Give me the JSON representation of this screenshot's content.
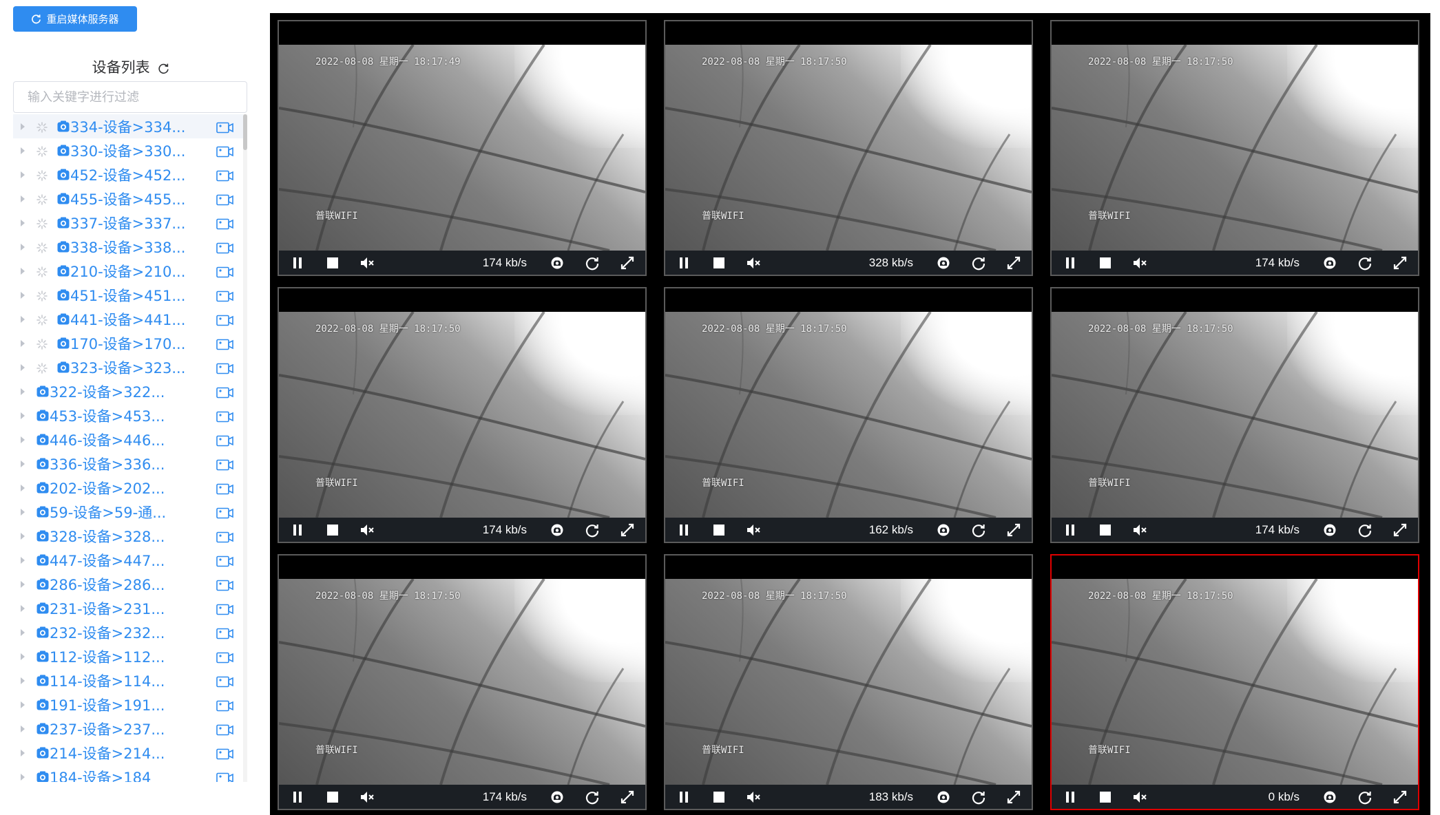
{
  "left_panel": {
    "restart_button_label": "重启媒体服务器",
    "device_list_title": "设备列表",
    "filter_placeholder": "输入关键字进行过滤",
    "accent_color": "#2f8cf0",
    "devices": [
      {
        "label": "334-设备>334...",
        "loading": true
      },
      {
        "label": "330-设备>330...",
        "loading": true
      },
      {
        "label": "452-设备>452...",
        "loading": true
      },
      {
        "label": "455-设备>455...",
        "loading": true
      },
      {
        "label": "337-设备>337...",
        "loading": true
      },
      {
        "label": "338-设备>338...",
        "loading": true
      },
      {
        "label": "210-设备>210...",
        "loading": true
      },
      {
        "label": "451-设备>451...",
        "loading": true
      },
      {
        "label": "441-设备>441...",
        "loading": true
      },
      {
        "label": "170-设备>170...",
        "loading": true
      },
      {
        "label": "323-设备>323...",
        "loading": true
      },
      {
        "label": "322-设备>322...",
        "loading": false
      },
      {
        "label": "453-设备>453...",
        "loading": false
      },
      {
        "label": "446-设备>446...",
        "loading": false
      },
      {
        "label": "336-设备>336...",
        "loading": false
      },
      {
        "label": "202-设备>202...",
        "loading": false
      },
      {
        "label": "59-设备>59-通...",
        "loading": false
      },
      {
        "label": "328-设备>328...",
        "loading": false
      },
      {
        "label": "447-设备>447...",
        "loading": false
      },
      {
        "label": "286-设备>286...",
        "loading": false
      },
      {
        "label": "231-设备>231...",
        "loading": false
      },
      {
        "label": "232-设备>232...",
        "loading": false
      },
      {
        "label": "112-设备>112...",
        "loading": false
      },
      {
        "label": "114-设备>114...",
        "loading": false
      },
      {
        "label": "191-设备>191...",
        "loading": false
      },
      {
        "label": "237-设备>237...",
        "loading": false
      },
      {
        "label": "214-设备>214...",
        "loading": false
      },
      {
        "label": "184-设备>184",
        "loading": false
      }
    ]
  },
  "players": [
    {
      "timestamp": "2022-08-08 星期一 18:17:49",
      "channel_name": "普联WIFI",
      "bitrate": "174 kb/s",
      "selected": false
    },
    {
      "timestamp": "2022-08-08 星期一 18:17:50",
      "channel_name": "普联WIFI",
      "bitrate": "328 kb/s",
      "selected": false
    },
    {
      "timestamp": "2022-08-08 星期一 18:17:50",
      "channel_name": "普联WIFI",
      "bitrate": "174 kb/s",
      "selected": false
    },
    {
      "timestamp": "2022-08-08 星期一 18:17:50",
      "channel_name": "普联WIFI",
      "bitrate": "174 kb/s",
      "selected": false
    },
    {
      "timestamp": "2022-08-08 星期一 18:17:50",
      "channel_name": "普联WIFI",
      "bitrate": "162 kb/s",
      "selected": false
    },
    {
      "timestamp": "2022-08-08 星期一 18:17:50",
      "channel_name": "普联WIFI",
      "bitrate": "174 kb/s",
      "selected": false
    },
    {
      "timestamp": "2022-08-08 星期一 18:17:50",
      "channel_name": "普联WIFI",
      "bitrate": "174 kb/s",
      "selected": false
    },
    {
      "timestamp": "2022-08-08 星期一 18:17:50",
      "channel_name": "普联WIFI",
      "bitrate": "183 kb/s",
      "selected": false
    },
    {
      "timestamp": "2022-08-08 星期一 18:17:50",
      "channel_name": "普联WIFI",
      "bitrate": "0 kb/s",
      "selected": true
    }
  ],
  "player_controls": [
    "pause-icon",
    "stop-icon",
    "mute-icon",
    "screenshot-icon",
    "refresh-icon",
    "fullscreen-icon"
  ],
  "colors": {
    "selected_border": "#e00000",
    "control_bar": "#1b1f24"
  }
}
